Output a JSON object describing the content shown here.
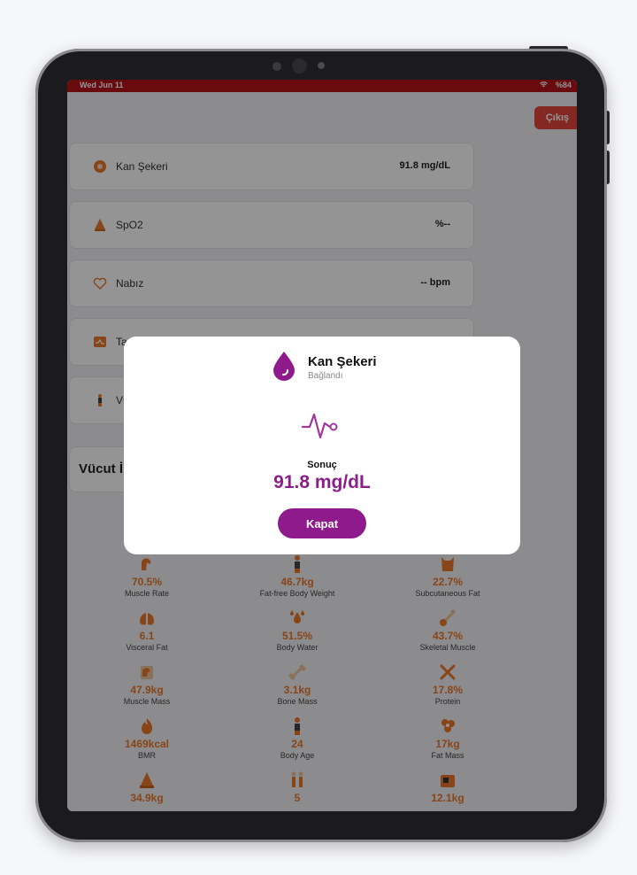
{
  "status_bar": {
    "time": "Wed Jun 11",
    "battery": "%84"
  },
  "header": {
    "exit_label": "Çıkış"
  },
  "vitals": [
    {
      "label": "Kan Şekeri",
      "value": "91.8 mg/dL",
      "icon": "blood-sugar-icon"
    },
    {
      "label": "SpO2",
      "value": "%--",
      "icon": "oxygen-icon"
    },
    {
      "label": "Nabız",
      "value": "-- bpm",
      "icon": "heart-icon"
    },
    {
      "label": "Ta",
      "value": "",
      "icon": "scale-icon"
    },
    {
      "label": "Vü",
      "value": "",
      "icon": "body-icon"
    }
  ],
  "section": {
    "title": "Vücut İ"
  },
  "metrics": [
    {
      "value": "70.5%",
      "label": "Muscle Rate"
    },
    {
      "value": "46.7kg",
      "label": "Fat-free Body Weight"
    },
    {
      "value": "22.7%",
      "label": "Subcutaneous Fat"
    },
    {
      "value": "6.1",
      "label": "Visceral Fat"
    },
    {
      "value": "51.5%",
      "label": "Body Water"
    },
    {
      "value": "43.7%",
      "label": "Skeletal Muscle"
    },
    {
      "value": "47.9kg",
      "label": "Muscle Mass"
    },
    {
      "value": "3.1kg",
      "label": "Bone Mass"
    },
    {
      "value": "17.8%",
      "label": "Protein"
    },
    {
      "value": "1469kcal",
      "label": "BMR"
    },
    {
      "value": "24",
      "label": "Body Age"
    },
    {
      "value": "17kg",
      "label": "Fat Mass"
    },
    {
      "value": "34.9kg",
      "label": ""
    },
    {
      "value": "5",
      "label": ""
    },
    {
      "value": "12.1kg",
      "label": ""
    }
  ],
  "modal": {
    "title": "Kan Şekeri",
    "subtitle": "Bağlandı",
    "result_label": "Sonuç",
    "result_value": "91.8 mg/dL",
    "close_label": "Kapat"
  },
  "colors": {
    "accent": "#8e1a8c",
    "metric": "#e8782c",
    "status": "#b5121b",
    "exit": "#e2453c"
  }
}
